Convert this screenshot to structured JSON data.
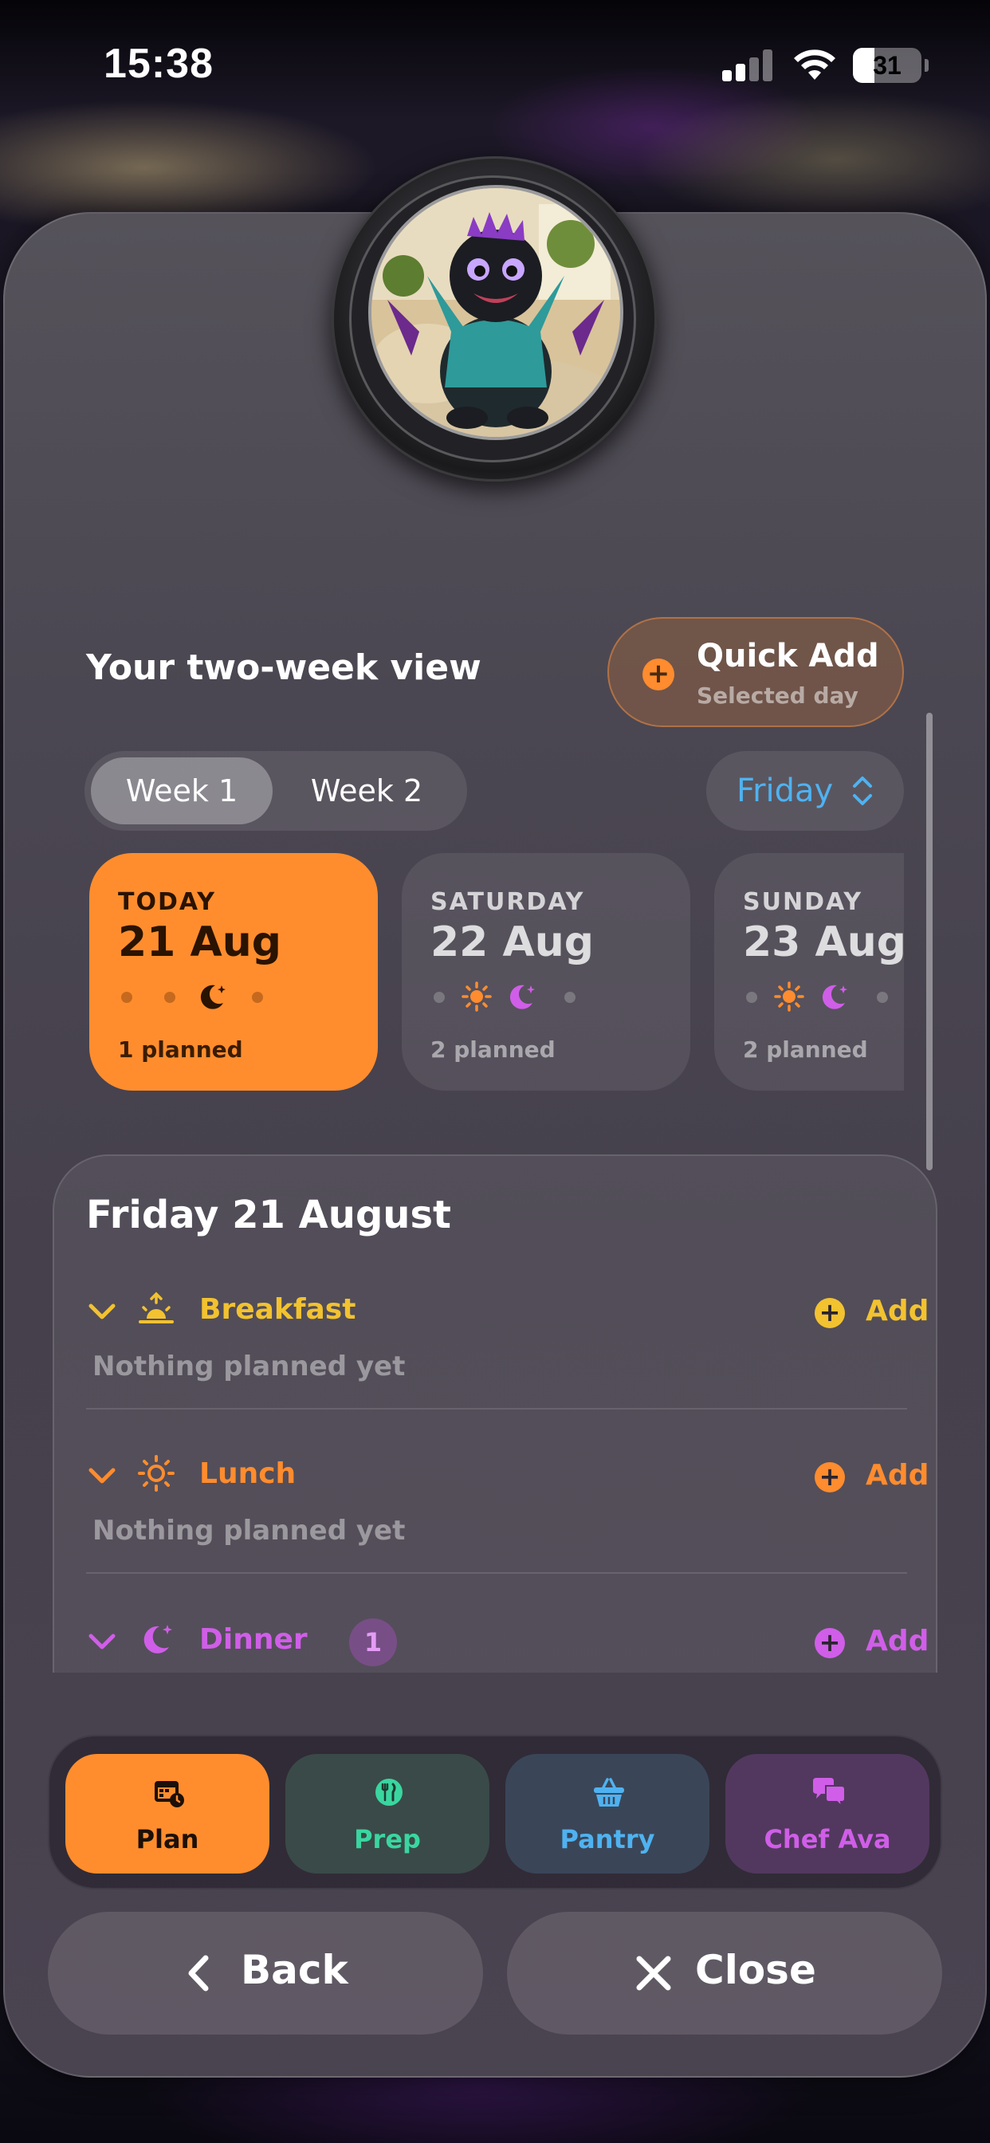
{
  "status_bar": {
    "time": "15:38",
    "battery": "31",
    "battery_level": 0.31
  },
  "header": {
    "title": "Your two-week view"
  },
  "quick_add": {
    "label": "Quick Add",
    "sublabel": "Selected day"
  },
  "week_tabs": [
    {
      "label": "Week 1",
      "selected": true
    },
    {
      "label": "Week 2",
      "selected": false
    }
  ],
  "day_picker": {
    "value": "Friday"
  },
  "days": [
    {
      "name": "TODAY",
      "date": "21 Aug",
      "planned": "1 planned",
      "today": true,
      "meals": [
        "none",
        "none",
        "dinner",
        "none"
      ]
    },
    {
      "name": "SATURDAY",
      "date": "22 Aug",
      "planned": "2 planned",
      "today": false,
      "meals": [
        "none",
        "lunch",
        "dinner",
        "none"
      ]
    },
    {
      "name": "SUNDAY",
      "date": "23 Aug",
      "planned": "2 planned",
      "today": false,
      "meals": [
        "none",
        "lunch",
        "dinner",
        "none"
      ]
    }
  ],
  "day_panel": {
    "title": "Friday 21 August",
    "meals": [
      {
        "name": "Breakfast",
        "empty_text": "Nothing planned yet",
        "add_label": "Add",
        "color": "#f2c230",
        "icon": "sunrise-icon"
      },
      {
        "name": "Lunch",
        "empty_text": "Nothing planned yet",
        "add_label": "Add",
        "color": "#ff8c2e",
        "icon": "sun-icon"
      },
      {
        "name": "Dinner",
        "count": "1",
        "add_label": "Add",
        "color": "#d05ee8",
        "icon": "moon-icon"
      }
    ]
  },
  "tabs": [
    {
      "label": "Plan",
      "icon": "calendar-icon",
      "color": "#1c1008",
      "bg": "#ff8d2e",
      "selected": true
    },
    {
      "label": "Prep",
      "icon": "utensils-icon",
      "color": "#3ad6a0",
      "bg": "#3a4a48",
      "selected": false
    },
    {
      "label": "Pantry",
      "icon": "basket-icon",
      "color": "#4fb2f0",
      "bg": "#3a4658",
      "selected": false
    },
    {
      "label": "Chef Ava",
      "icon": "chat-bubbles-icon",
      "color": "#d05ee8",
      "bg": "#52385e",
      "selected": false
    }
  ],
  "actions": {
    "back_label": "Back",
    "close_label": "Close"
  },
  "colors": {
    "accent_orange": "#ff8d2e",
    "accent_blue": "#4fb2f0",
    "accent_purple": "#d05ee8",
    "accent_yellow": "#f2c230"
  }
}
